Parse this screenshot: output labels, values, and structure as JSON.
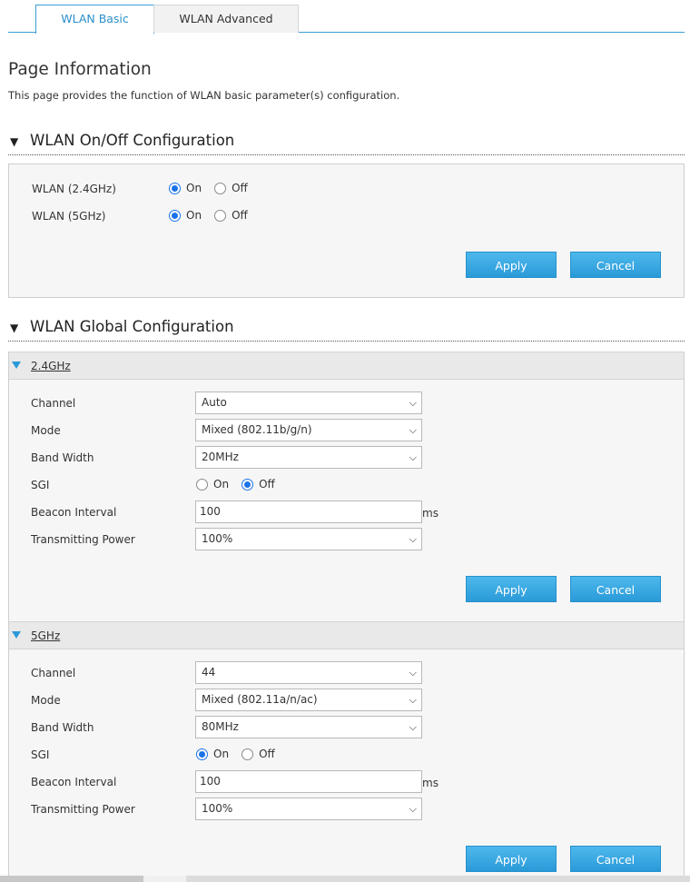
{
  "tabs": [
    {
      "label": "WLAN Basic",
      "active": true
    },
    {
      "label": "WLAN Advanced",
      "active": false
    }
  ],
  "page": {
    "title": "Page Information",
    "description": "This page provides the function of WLAN basic parameter(s) configuration."
  },
  "onoff": {
    "section_title": "WLAN On/Off Configuration",
    "rows": [
      {
        "label": "WLAN (2.4GHz)",
        "on_label": "On",
        "off_label": "Off",
        "selected": "On"
      },
      {
        "label": "WLAN (5GHz)",
        "on_label": "On",
        "off_label": "Off",
        "selected": "On"
      }
    ],
    "apply_label": "Apply",
    "cancel_label": "Cancel"
  },
  "global": {
    "section_title": "WLAN Global Configuration",
    "band24": {
      "title": "2.4GHz",
      "channel_label": "Channel",
      "channel_value": "Auto",
      "mode_label": "Mode",
      "mode_value": "Mixed (802.11b/g/n)",
      "bandwidth_label": "Band Width",
      "bandwidth_value": "20MHz",
      "sgi_label": "SGI",
      "sgi_on": "On",
      "sgi_off": "Off",
      "sgi_selected": "Off",
      "beacon_label": "Beacon Interval",
      "beacon_value": "100",
      "beacon_unit": "ms",
      "power_label": "Transmitting Power",
      "power_value": "100%",
      "apply_label": "Apply",
      "cancel_label": "Cancel"
    },
    "band5": {
      "title": "5GHz",
      "channel_label": "Channel",
      "channel_value": "44",
      "mode_label": "Mode",
      "mode_value": "Mixed (802.11a/n/ac)",
      "bandwidth_label": "Band Width",
      "bandwidth_value": "80MHz",
      "sgi_label": "SGI",
      "sgi_on": "On",
      "sgi_off": "Off",
      "sgi_selected": "On",
      "beacon_label": "Beacon Interval",
      "beacon_value": "100",
      "beacon_unit": "ms",
      "power_label": "Transmitting Power",
      "power_value": "100%",
      "apply_label": "Apply",
      "cancel_label": "Cancel"
    }
  },
  "colors": {
    "accent": "#2a9ad8",
    "radio": "#1a73e8"
  }
}
